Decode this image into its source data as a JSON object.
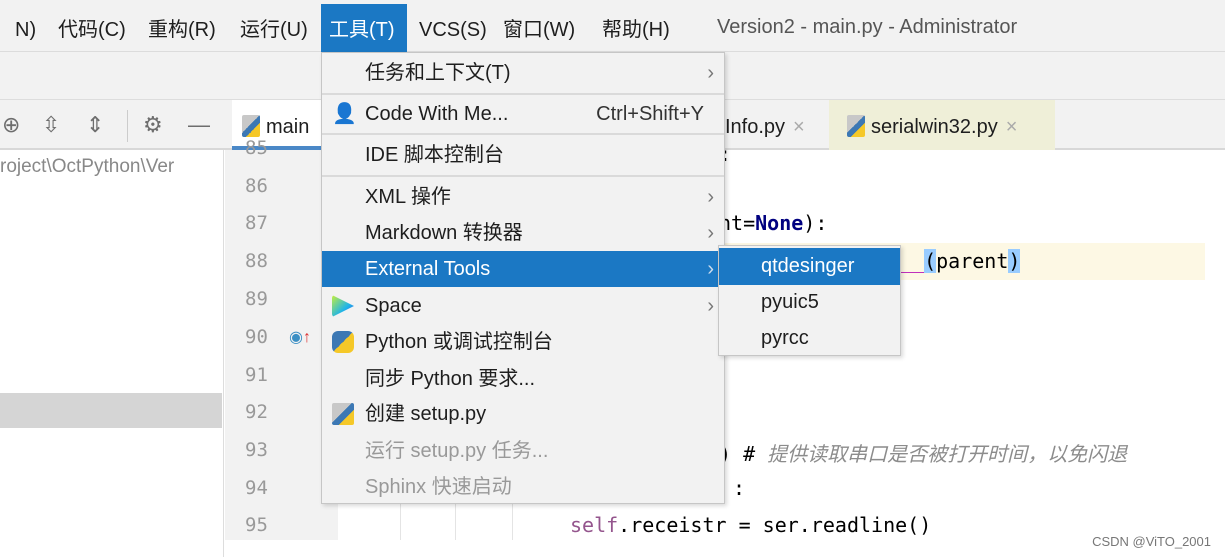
{
  "menubar": {
    "items": [
      "N)",
      "代码(C)",
      "重构(R)",
      "运行(U)",
      "工具(T)",
      "VCS(S)",
      "窗口(W)",
      "帮助(H)"
    ],
    "active": "工具(T)",
    "window_title": "Version2 - main.py - Administrator"
  },
  "tabs": [
    {
      "label": "main"
    },
    {
      "label": "Info.py"
    },
    {
      "label": "serialwin32.py"
    }
  ],
  "project_path": "roject\\OctPython\\Ver",
  "line_numbers": [
    "85",
    "86",
    "87",
    "88",
    "89",
    "90",
    "91",
    "92",
    "93",
    "94",
    "95"
  ],
  "code": {
    "l87a": "nt=",
    "l87kw": "None",
    "l87b": "):",
    "l84": ":",
    "l88a": "__",
    "l88b": "(",
    "l88c": "parent",
    "l88d": ")",
    "l93a": ") # ",
    "l93cmt": "提供读取串口是否被打开时间，以免闪退",
    "l94": ":",
    "l95self": "self",
    "l95rest": ".receistr = ser.readline()"
  },
  "tools_menu": {
    "items": [
      {
        "label": "任务和上下文(T)",
        "submenu": true
      },
      {
        "label": "Code With Me...",
        "shortcut": "Ctrl+Shift+Y",
        "icon": "users-icon"
      },
      {
        "label": "IDE 脚本控制台"
      },
      {
        "label": "XML 操作",
        "submenu": true
      },
      {
        "label": "Markdown 转换器",
        "submenu": true
      },
      {
        "label": "External Tools",
        "submenu": true,
        "highlighted": true
      },
      {
        "label": "Space",
        "submenu": true,
        "icon": "space-icon"
      },
      {
        "label": "Python 或调试控制台",
        "icon": "python-icon"
      },
      {
        "label": "同步 Python 要求..."
      },
      {
        "label": "创建 setup.py",
        "icon": "python-file-icon"
      },
      {
        "label": "运行 setup.py 任务...",
        "disabled": true
      },
      {
        "label": "Sphinx 快速启动",
        "disabled": true
      }
    ]
  },
  "external_tools_submenu": {
    "items": [
      "qtdesinger",
      "pyuic5",
      "pyrcc"
    ],
    "highlighted": "qtdesinger"
  },
  "arrow": "›",
  "close": "×",
  "watermark": "CSDN @ViTO_2001",
  "colors": {
    "accent": "#1b78c4",
    "menu_bg": "#f2f2f2",
    "caret_row": "#fdf8e4"
  }
}
